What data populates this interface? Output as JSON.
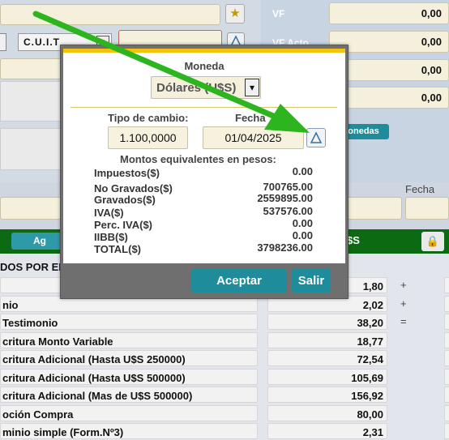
{
  "background": {
    "cuit_label": "C.U.I.T",
    "vf_label": "VF",
    "vf_acto_label": "VF Acto",
    "vf_value": "0,00",
    "vf_acto_value": "0,00",
    "right_value_3": "0,00",
    "right_value_4": "0,00",
    "monedas_button": "lonedas",
    "fecha_label": "Fecha",
    "green_button": "Ag",
    "currency_label": "$S",
    "section_title": "DOS POR EL"
  },
  "table": {
    "rows": [
      {
        "name": "",
        "value": "1,80",
        "op": "+"
      },
      {
        "name": "nio",
        "value": "2,02",
        "op": "+"
      },
      {
        "name": "Testimonio",
        "value": "38,20",
        "op": "="
      },
      {
        "name": "critura Monto Variable",
        "value": "18,77",
        "op": ""
      },
      {
        "name": "critura Adicional (Hasta U$S 250000)",
        "value": "72,54",
        "op": ""
      },
      {
        "name": "critura Adicional (Hasta U$S 500000)",
        "value": "105,69",
        "op": ""
      },
      {
        "name": "critura Adicional (Mas de U$S 500000)",
        "value": "156,92",
        "op": ""
      },
      {
        "name": "oción Compra",
        "value": "80,00",
        "op": ""
      },
      {
        "name": "minio simple (Form.Nº3)",
        "value": "2,31",
        "op": ""
      }
    ]
  },
  "modal": {
    "moneda_label": "Moneda",
    "moneda_value": "Dólares (U$S)",
    "tipo_cambio_label": "Tipo de cambio:",
    "tipo_cambio_value": "1.100,0000",
    "fecha_label": "Fecha",
    "fecha_value": "01/04/2025",
    "montos_title": "Montos equivalentes en pesos:",
    "montos": [
      {
        "label": "Impuestos($)",
        "value": "0.00"
      },
      {
        "label": "No Gravados($)",
        "value": "700765.00"
      },
      {
        "label": "Gravados($)",
        "value": "2559895.00"
      },
      {
        "label": "IVA($)",
        "value": "537576.00"
      },
      {
        "label": "Perc. IVA($)",
        "value": "0.00"
      },
      {
        "label": "IIBB($)",
        "value": "0.00"
      },
      {
        "label": "TOTAL($)",
        "value": "3798236.00"
      }
    ],
    "aceptar_label": "Aceptar",
    "salir_label": "Salir"
  },
  "icons": {
    "star": "★",
    "lock": "🔒",
    "chevron": "▾"
  },
  "colors": {
    "green_bar": "#0c6a12",
    "teal_button": "#1f8c9c",
    "modal_accent": "#f4c20d",
    "annotation_arrow": "#2db51f"
  }
}
